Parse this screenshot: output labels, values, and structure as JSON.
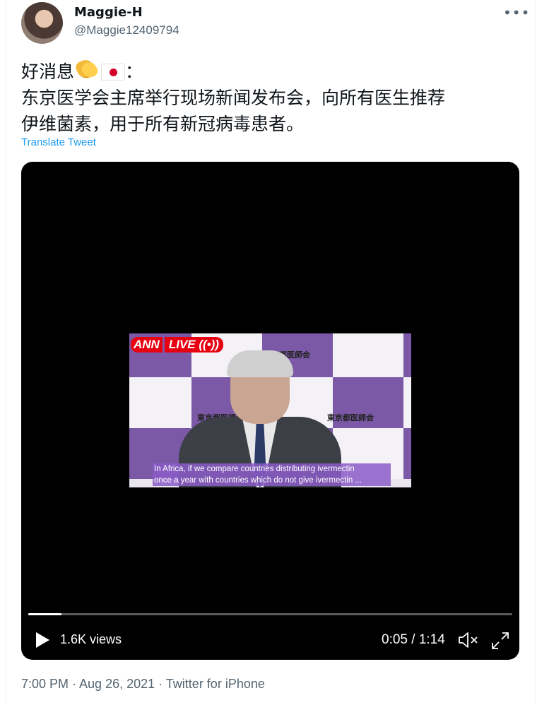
{
  "author": {
    "name": "Maggie-H",
    "handle": "@Maggie12409794"
  },
  "tweet": {
    "line1_text": "好消息",
    "line1_suffix": "：",
    "line2": "东京医学会主席举行现场新闻发布会，向所有医生推荐",
    "line3": "伊维菌素，用于所有新冠病毒患者。",
    "emojis": [
      "clapping-hands-emoji",
      "japan-flag-emoji"
    ],
    "translate_label": "Translate Tweet"
  },
  "video": {
    "broadcaster": "ANN",
    "live_label": "LIVE",
    "live_icon": "broadcast-icon",
    "backdrop_label": "東京都医師会",
    "subtitle_line1": "In Africa, if we compare countries distributing ivermectin",
    "subtitle_line2": "once a year with countries which do not give ivermectin ...",
    "views": "1.6K views",
    "time": "0:05 / 1:14",
    "progress_fraction": 0.068,
    "accent_color": "#1d9bf0",
    "live_color": "#e60012",
    "backdrop_purple": "#7b59a6"
  },
  "meta": {
    "line": "7:00 PM · Aug 26, 2021 · Twitter for iPhone"
  }
}
